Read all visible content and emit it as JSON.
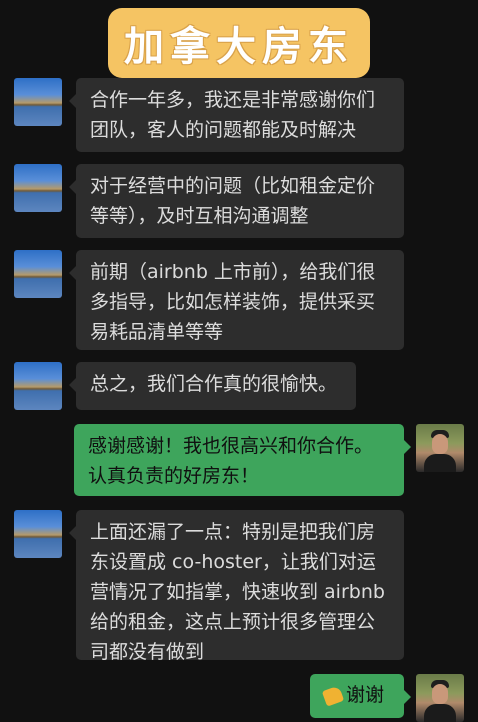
{
  "banner": {
    "title": "加拿大房东"
  },
  "messages": [
    {
      "side": "left",
      "lines": [
        "合作一年多，我还是非常感谢你们",
        "团队，客人的问题都能及时解决"
      ]
    },
    {
      "side": "left",
      "lines": [
        "对于经营中的问题（比如租金定价",
        "等等），及时互相沟通调整"
      ]
    },
    {
      "side": "left",
      "lines": [
        "前期（airbnb 上市前），给我们很",
        "多指导，比如怎样装饰，提供采买",
        "易耗品清单等等"
      ]
    },
    {
      "side": "left",
      "lines": [
        "总之，我们合作真的很愉快。"
      ]
    },
    {
      "side": "right",
      "lines": [
        "感谢感谢！我也很高兴和你合作。",
        "认真负责的好房东！"
      ]
    },
    {
      "side": "left",
      "lines": [
        "上面还漏了一点：特别是把我们房",
        "东设置成 co-hoster，让我们对运",
        "营情况了如指掌，快速收到 airbnb",
        "给的租金，这点上预计很多管理公",
        "司都没有做到"
      ]
    },
    {
      "side": "right",
      "lines": [
        "谢谢"
      ],
      "emoji": "thumbs-up-icon"
    }
  ]
}
